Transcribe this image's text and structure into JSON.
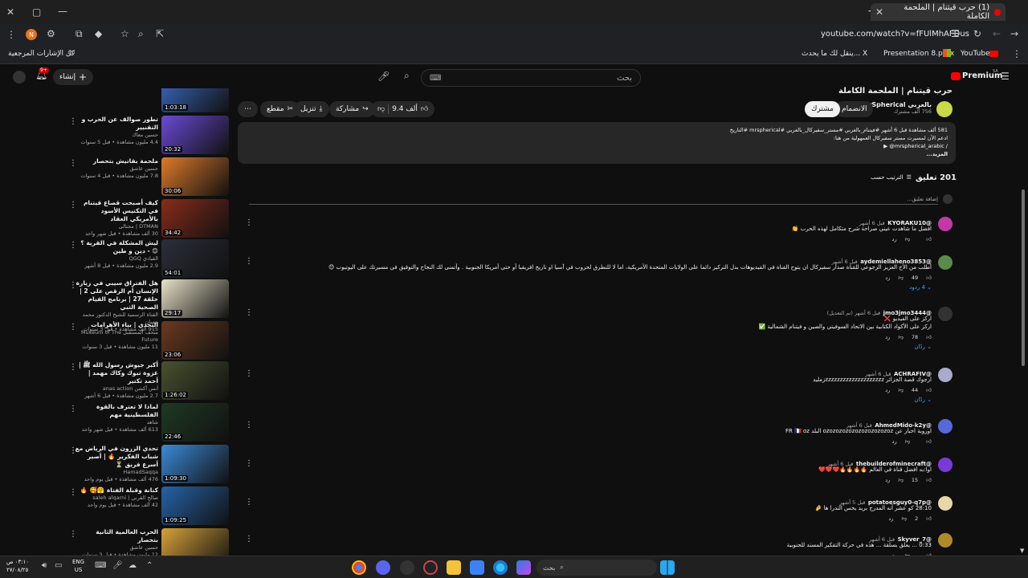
{
  "browser": {
    "tab_title": "(1) حرب قيتنام | الملحمة الكاملة",
    "url": "youtube.com/watch?v=fFUlMhAFDus",
    "bookmarks": [
      "YouTube",
      "Presentation 8.pptx",
      "ينقل لك ما يحدث... X",
      "كل الإشارات المرجعية"
    ]
  },
  "youtube": {
    "logo": "Premium",
    "logo_badge": "SA",
    "search_placeholder": "بحث",
    "create_label": "إنشاء",
    "notif_count": "9+"
  },
  "video": {
    "title": "حرب قيتنام | الملحمة الكاملة",
    "channel": "بالعربي MrSpherical",
    "subscribers": "756 ألف مشترك",
    "subscribed_label": "مشترك",
    "join_label": "الانضمام",
    "likes": "9.4 ألف",
    "share_label": "مشاركة",
    "download_label": "تنزيل",
    "clip_label": "مقطع",
    "desc_stats": "581 ألف مشاهدة  قبل 6 أشهر  #فيتنام_بالعربي #مستر_سفيركال_بالعربي #mrspherical #التاريخ",
    "desc_line2": "ادعم الآن لمسيرت مستر سفيركال العمهولية من هنا:",
    "desc_line3": "▶ @mrspherical_arabic /",
    "desc_more": "...المزيد"
  },
  "comments": {
    "count_label": "201 تعليق",
    "sort_label": "الترتيب حسب",
    "add_placeholder": "إضافة تعليق...",
    "items": [
      {
        "name": "@KYORAKU10",
        "time": "قبل 6 أشهر",
        "text": "افضل ما شاهدت عيني صراحة شرح متكامل لهذه الحرب 👏",
        "likes": "",
        "replies": ""
      },
      {
        "name": "@aydemiellaheno3853",
        "time": "قبل 6 أشهر",
        "text": "أطلب من الأخ العزيز الرجوعي للقناة صدار سفيركال ان يتوح القناة في الفيديوهات بدل التركيز دائما على الولايات المتحدة الأمريكية، اما لا للتطرق لحروب في آسيا او تاريخ افريقيا أو حتى أمريكا الجنوبية . وأتمنى لك النجاح والتوفيق في مسيرتك على اليوتيوب 😊",
        "likes": "49",
        "replies": "4 ردود"
      },
      {
        "name": "@jmo3jmo3444",
        "time": "قبل 6 أشهر (تم التعديل)",
        "text": "اركز على الفيديو ❌",
        "text2": "اركز على الأكواد الكتابية بين الاتحاد السوفيتي والصين و فيتنام الشمالية ✅",
        "likes": "78",
        "replies": "ردّان"
      },
      {
        "name": "@ACHRAFIV",
        "time": "قبل 6 أشهر",
        "text": "ارجوك قصة الجزائر zzzzzzzzzzzzzzzzzzzzزمليد",
        "likes": "44",
        "replies": "ردّان"
      },
      {
        "name": "@AhmedMido-k2y",
        "time": "قبل 6 أشهر",
        "text": "اوروبة اخبار عن ozozozozozozozozozozoz البلد FR 🇫🇷 oz",
        "likes": "",
        "replies": ""
      },
      {
        "name": "@thebuilderofminecraft",
        "time": "قبل 6 أشهر",
        "text": "اوا:به افضل قناة في العالم 🔥🔥🔥🔥❤️❤️❤️",
        "likes": "15",
        "replies": ""
      },
      {
        "name": "@potatoesguy0-q7p",
        "time": "قبل 5 أشهر",
        "text": "28:10 كو عشر أنه المدرج بريد يحس التدرا ها 🤌",
        "likes": "2",
        "replies": ""
      },
      {
        "name": "@Skyver_7",
        "time": "قبل 6 أشهر",
        "text": "0:33 ... يعلق بسلقة ... هذه في حركة التفكير المسند للجنوبية",
        "likes": "",
        "replies": ""
      }
    ]
  },
  "sidebar_videos": [
    {
      "title": "",
      "channel": "القيادي QGQ",
      "meta": "8.4 مليون مشاهدة • قبل 3 سنوات",
      "dur": "1:03:18",
      "color": "#3a6bc4"
    },
    {
      "title": "تطور صوالف عن الحرب و التقنيير",
      "channel": "حسين معاك",
      "meta": "4.4 مليون مشاهدة • قبل 5 سنوات",
      "dur": "20:32",
      "color": "#6a4bd6"
    },
    {
      "title": "ملحمة بقاتيش بتحصار",
      "channel": "حسين عاشق",
      "meta": "7.8 مليون مشاهدة • قبل 4 سنوات",
      "dur": "30:06",
      "color": "#e07a2a"
    },
    {
      "title": "كيف أصبحت قصاع قيتنام في التكتيس الأسود بالأمريكي العقاد",
      "channel": "DTMAN | مجنالى",
      "meta": "30 ألف مشاهدة • قبل شهر واحد",
      "dur": "34:42",
      "color": "#8a2b1a"
    },
    {
      "title": "ليش المشكلة في القرية ؟ 😊 - دين و طين",
      "channel": "القيادي QGQ",
      "meta": "2.9 مليون مشاهدة • قبل 8 أشهر",
      "dur": "54:01",
      "color": "#2b2f3a"
    },
    {
      "title": "هل الفتراق سيبي في زيارة الإنسان أم الرقص على 2 | حلقة 27 | برنامج القيام الصحية الثبي",
      "channel": "القناة الرسمية للشيخ الدكتور محمد حسان",
      "meta": "915 ألف مشاهدة • قبل 3 سنوات",
      "dur": "29:17",
      "color": "#e8e2c8"
    },
    {
      "title": "التحدي | بناء الأهرامات",
      "channel": "متحف المستقبل Museum of The Future",
      "meta": "11 مليون مشاهدة • قبل 3 سنوات",
      "dur": "23:06",
      "color": "#6b3a1f"
    },
    {
      "title": "أكبر جيوش رسول الله ﷺ | غزوة تبوك وكاك مهمد | أحمد تكتير",
      "channel": "أنس آكشن anas action",
      "meta": "2.7 مليون مشاهدة • قبل 6 أشهر",
      "dur": "1:26:02",
      "color": "#4a5230"
    },
    {
      "title": "لماذا لا تعترف بالقوة الفلسطينية مهم",
      "channel": "شاهد",
      "meta": "613 ألف مشاهدة • قبل شهر واحد",
      "dur": "22:46",
      "color": "#1f3a24"
    },
    {
      "title": "تحدي الزرون في الرياض مع شباب الفكرير 🔥 | أصير أسرع فريق ⏳",
      "channel": "HamadSaqqa",
      "meta": "476 ألف مشاهدة • قبل يوم واحد",
      "dur": "1:09:30",
      "color": "#3c8ad8"
    },
    {
      "title": "كنانة وقبلة الفتاة 🤗🥰 🔥",
      "channel": "صالح القرني | saleh alqarni",
      "meta": "42 ألف مشاهدة • قبل يوم واحد",
      "dur": "1:09:25",
      "color": "#2563a8"
    },
    {
      "title": "الحرب العالمية الثانية بتحصار",
      "channel": "حسين عاشق",
      "meta": "12 مليون مشاهدة • قبل 3 سنوات",
      "dur": "",
      "color": "#d8a23a"
    }
  ],
  "taskbar": {
    "lang": "ENG",
    "region": "US",
    "time": "٠٣:١٠ ص",
    "date": "٢٧/٠٨/٢٥",
    "search_label": "بحث"
  }
}
